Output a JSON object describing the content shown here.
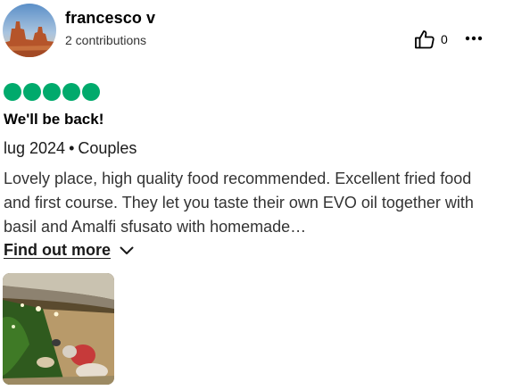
{
  "reviewer": {
    "name": "francesco v",
    "contributions": "2 contributions",
    "avatar_icon": "desert-landscape-avatar"
  },
  "actions": {
    "helpful_count": "0",
    "helpful_icon": "thumbs-up-icon",
    "more_icon": "more-dots-icon"
  },
  "rating": {
    "value": 5,
    "max": 5,
    "color": "#00aa6c"
  },
  "review": {
    "title": "We'll be back!",
    "date": "lug 2024",
    "separator": "•",
    "trip_type": "Couples",
    "text": "Lovely place, high quality food recommended. Excellent fried food and first course. They let you taste their own EVO oil together with basil and Amalfi sfusato with homemade…",
    "find_more_label": "Find out more",
    "find_more_icon": "chevron-down-icon"
  },
  "photos": [
    {
      "icon": "restaurant-terrace-photo"
    }
  ]
}
